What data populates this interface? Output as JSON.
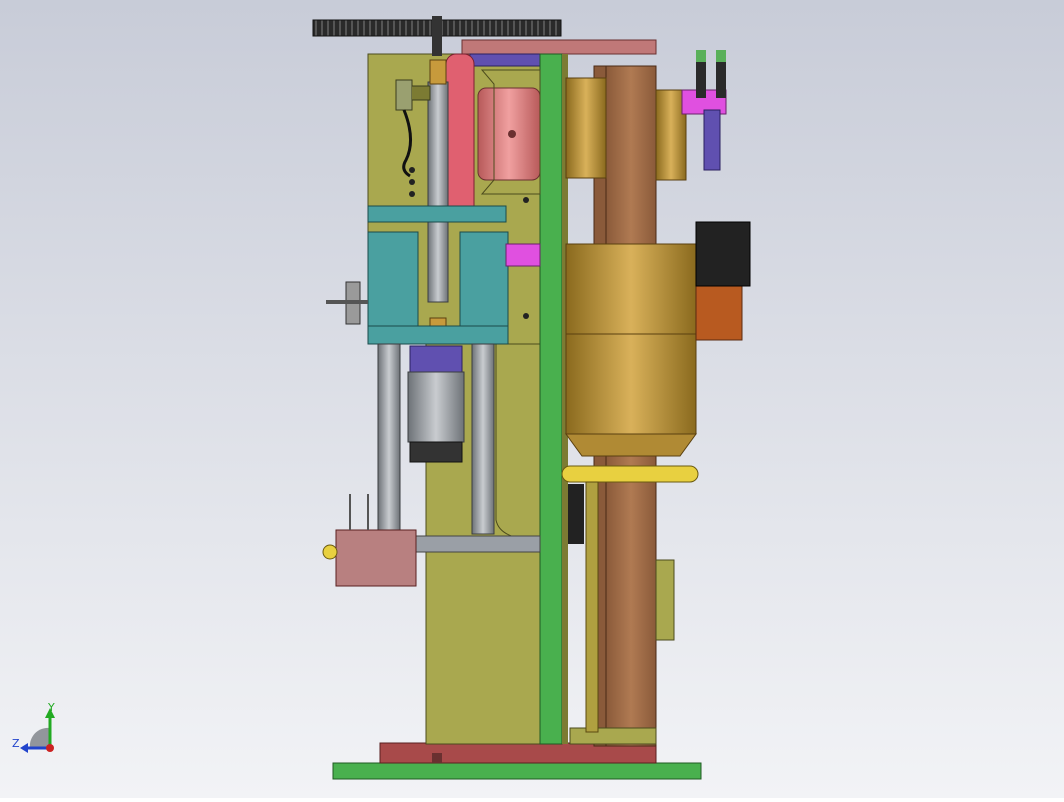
{
  "viewport": {
    "background_top": "#c8ccd8",
    "background_bottom": "#f2f3f6"
  },
  "colors": {
    "olive_plate": "#a9a84f",
    "olive_dark": "#7c7b33",
    "green_plate": "#49b04e",
    "brown_column": "#a0704c",
    "maroon_base": "#a84a4a",
    "motor_gold": "#c79a3c",
    "teal_block": "#4aa0a0",
    "pink_disc": "#e06070",
    "gear_dark": "#1e1e1e",
    "grey_rod": "#8a8f96",
    "orange_box": "#b85a20",
    "magenta": "#e050e0",
    "purple": "#6050b0"
  },
  "triad": {
    "y_label": "Y",
    "z_label": "Z",
    "y_color": "#22aa22",
    "z_color": "#2244cc",
    "x_color": "#cc2222"
  }
}
